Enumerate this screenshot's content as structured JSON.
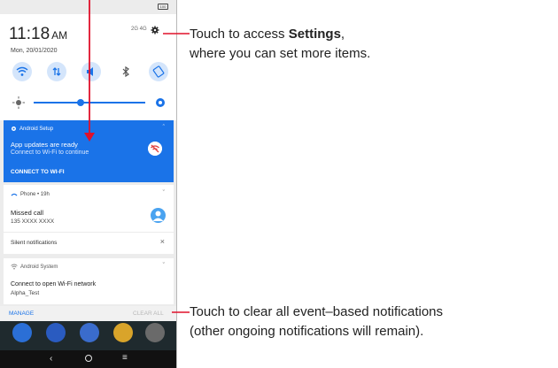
{
  "status_bar": {
    "battery": "100"
  },
  "quick_settings": {
    "time": "11:18",
    "ampm": "AM",
    "date": "Mon, 20/01/2020",
    "signal_text": "2G 4G"
  },
  "notifications": {
    "android_setup": {
      "app": "Android Setup",
      "title": "App updates are ready",
      "subtitle": "Connect to Wi-Fi to continue",
      "action": "CONNECT TO WI-FI"
    },
    "phone": {
      "app": "Phone • 19h",
      "title": "Missed call",
      "number": "135 XXXX XXXX"
    },
    "silent": {
      "label": "Silent notifications"
    },
    "android_system": {
      "app": "Android System",
      "title": "Connect to open Wi-Fi network",
      "network": "Alpha_Test"
    }
  },
  "footer": {
    "manage": "MANAGE",
    "clear_all": "CLEAR ALL"
  },
  "annotations": {
    "settings_line1_pre": "Touch to access ",
    "settings_bold": "Settings",
    "settings_line1_post": ",",
    "settings_line2": "where you can set more items.",
    "clear_line1": "Touch to clear all event–based notifications",
    "clear_line2": "(other ongoing notifications will remain)."
  },
  "colors": {
    "accent": "#1a73e8",
    "arrow": "#e0102a",
    "callout_line": "#e0102a"
  },
  "icons": [
    "battery-icon",
    "gear-icon",
    "wifi-icon",
    "data-icon",
    "volume-icon",
    "bluetooth-icon",
    "rotate-icon",
    "brightness-low-icon",
    "brightness-high-icon",
    "wifi-off-icon",
    "phone-icon",
    "avatar-icon",
    "close-icon",
    "chevron-down-icon",
    "chevron-up-icon",
    "back-nav-icon",
    "home-nav-icon",
    "recents-nav-icon"
  ]
}
